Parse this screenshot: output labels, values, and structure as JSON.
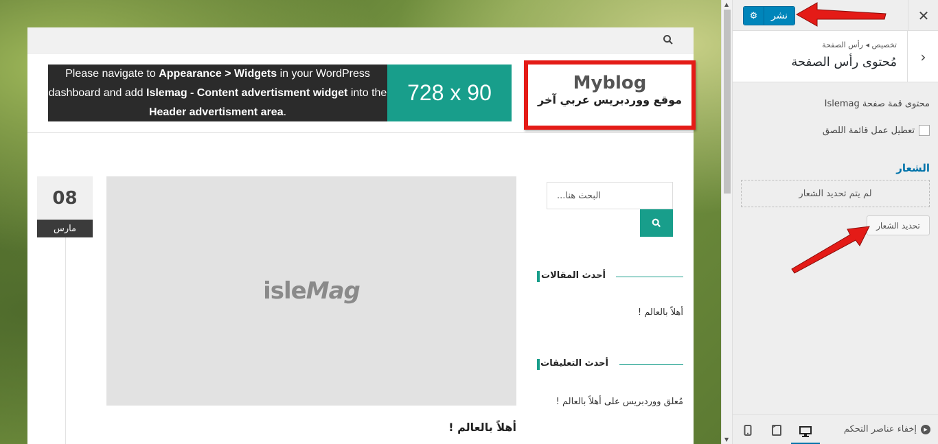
{
  "site": {
    "ad_text_parts": {
      "p1": "Please navigate to ",
      "p2": "Appearance > Widgets",
      "p3": " in your WordPress dashboard and add ",
      "p4": "Islemag - Content advertisment widget",
      "p5": " into the ",
      "p6": "Header advertisment area",
      "p7": "."
    },
    "ad_size": "728 x 90",
    "logo_title": "Myblog",
    "logo_tagline": "موقع ووردبريس عربي آخر",
    "date_day": "08",
    "date_month": "مارس",
    "featured_brand_1": "isle",
    "featured_brand_2": "Mag",
    "post_title": "أهلاً بالعالم !",
    "search_placeholder": "البحث هنا...",
    "widget_recent_posts": "أحدث المقالات",
    "recent_post_1": "أهلاً بالعالم !",
    "widget_recent_comments": "أحدث التعليقات",
    "recent_comment_1": "مُعلق ووردبريس على أهلاً بالعالم !"
  },
  "panel": {
    "publish_label": "نشر",
    "settings_icon": "gear-icon",
    "close_icon": "close-icon",
    "breadcrumb": "تخصيص ◂ رأس الصفحة",
    "section_title": "مُحتوى رأس الصفحة",
    "control_label": "محتوى قمة صفحة Islemag",
    "sticky_label": "تعطيل عمل قائمة اللصق",
    "logo_heading": "الشعار",
    "no_logo_text": "لم يتم تحديد الشعار",
    "select_logo_label": "تحديد الشعار",
    "hide_controls_label": "إخفاء عناصر التحكم"
  },
  "colors": {
    "accent": "#189e8b",
    "wp_blue": "#0085ba",
    "annotation_red": "#e41b17"
  }
}
